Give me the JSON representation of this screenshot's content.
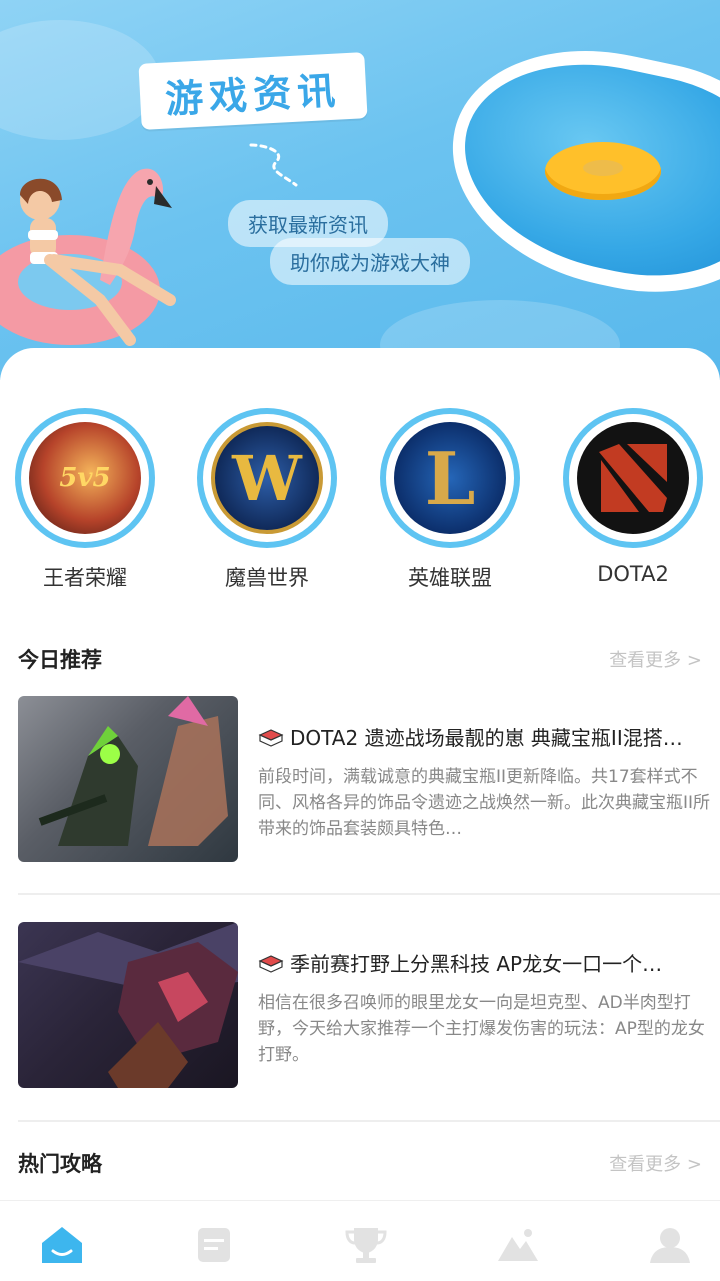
{
  "banner": {
    "title": "游戏资讯",
    "tagline_1": "获取最新资讯",
    "tagline_2": "助你成为游戏大神"
  },
  "games": [
    {
      "label": "王者荣耀",
      "icon": "honor-of-kings-icon",
      "badge_text": "5v5"
    },
    {
      "label": "魔兽世界",
      "icon": "world-of-warcraft-icon",
      "badge_text": "W"
    },
    {
      "label": "英雄联盟",
      "icon": "league-of-legends-icon",
      "badge_text": "L"
    },
    {
      "label": "DOTA2",
      "icon": "dota2-icon"
    }
  ],
  "today": {
    "title": "今日推荐",
    "more": "查看更多 >",
    "articles": [
      {
        "title": "DOTA2 遗迹战场最靓的崽 典藏宝瓶II混搭…",
        "desc": "前段时间，满载诚意的典藏宝瓶II更新降临。共17套样式不同、风格各异的饰品令遗迹之战焕然一新。此次典藏宝瓶II所带来的饰品套装颇具特色…"
      },
      {
        "title": "季前赛打野上分黑科技 AP龙女一口一个…",
        "desc": "相信在很多召唤师的眼里龙女一向是坦克型、AD半肉型打野，今天给大家推荐一个主打爆发伤害的玩法：AP型的龙女打野。"
      }
    ]
  },
  "hot": {
    "title": "热门攻略",
    "more": "查看更多 >"
  },
  "tabbar": {
    "active_color": "#3db6ee",
    "inactive_color": "#e2e2e2",
    "tabs": [
      "home-icon",
      "news-icon",
      "trophy-icon",
      "mountain-icon",
      "user-icon"
    ]
  }
}
